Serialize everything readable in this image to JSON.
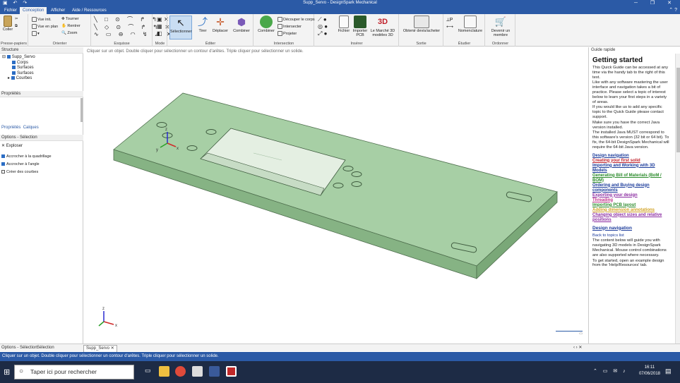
{
  "window": {
    "title": "Supp_Servo - DesignSpark Mechanical",
    "controls": "─  ❐  ✕"
  },
  "ribbon_tabs": [
    "Fichier",
    "Conception",
    "Afficher",
    "Aide / Ressources"
  ],
  "ribbon_active_tab": "Conception",
  "ribbon_groups": {
    "presse_papiers": {
      "label": "Presse-papiers",
      "coller": "Coller"
    },
    "orienter": {
      "label": "Orienter",
      "items": [
        "Vue init.",
        "Vue en plan",
        "Tourner",
        "Rentrer",
        "Zoom"
      ]
    },
    "esquisse": {
      "label": "Esquisse"
    },
    "mode": {
      "label": "Mode"
    },
    "editer": {
      "label": "Éditer",
      "buttons": [
        "Sélectionner",
        "Tirer",
        "Déplacer",
        "Combiner"
      ]
    },
    "intersection": {
      "label": "Intersection",
      "combine": "Combiner",
      "items": [
        "Découper le corps",
        "Intersecter",
        "Projeter"
      ]
    },
    "inserer": {
      "label": "Insérer",
      "items": [
        "Fichier",
        "Importer PCB",
        "Le Marché 3D modèles 3D"
      ]
    },
    "sortie": {
      "label": "Sortie",
      "items": [
        "Obtenir devis/acheter"
      ]
    },
    "etudier": {
      "label": "Étudier",
      "items": [
        "Nomenclature"
      ]
    },
    "ordonner": {
      "label": "Ordonner",
      "items": [
        "Devenir un membre"
      ]
    }
  },
  "structure_panel": {
    "title": "Structure",
    "root": "Supp_Servo",
    "children": [
      "Corps",
      "Surfaces",
      "Surfaces",
      "Courbes"
    ]
  },
  "properties_panel": {
    "title": "Propriétés",
    "tabs": [
      "Propriétés",
      "Calques"
    ]
  },
  "options_panel": {
    "title": "Options - Sélection",
    "mode": "Exploser",
    "options": [
      {
        "label": "Accrocher à la quadrillage",
        "checked": true
      },
      {
        "label": "Accrocher à l'angle",
        "checked": true
      },
      {
        "label": "Créer des courbes",
        "checked": false
      }
    ]
  },
  "viewport": {
    "hint": "Cliquer sur un objet. Double cliquer pour sélectionner un contour d'arêtes. Triple cliquer pour sélectionner un solide.",
    "axis_labels": [
      "x",
      "y",
      "z"
    ],
    "model_color": "#9cc79a"
  },
  "quick_guide": {
    "title": "Guide rapide",
    "heading": "Getting started",
    "paragraphs": [
      "This Quick Guide can be accessed at any time via the handy tab to the right of this text.",
      "Like with any software mastering the user interface and navigation takes a bit of practice. Please select a topic of interest below to learn your first steps in a variety of areas.",
      "If you would like us to add any specific topic to the Quick Guide please contact support.",
      "Make sure you have the correct Java version installed.",
      "The installed Java MUST correspond to this software's version (32 bit or 64 bit). To fix, the 64-bit DesignSpark Mechanical will require the 64-bit Java version."
    ],
    "links": [
      {
        "text": "Design navigation",
        "color": "#1a3a9a"
      },
      {
        "text": "Creating your first solid",
        "color": "#c0202a"
      },
      {
        "text": "Importing and Working with 3D Models",
        "color": "#1a3a9a"
      },
      {
        "text": "Generating Bill of Materials (BoM / BOM)",
        "color": "#2a8a2a"
      },
      {
        "text": "Ordering and Buying design components",
        "color": "#1a3a9a"
      },
      {
        "text": "Exporting your design",
        "color": "#8a2aa0"
      },
      {
        "text": "Threading",
        "color": "#c0308a"
      },
      {
        "text": "Importing PCB layout",
        "color": "#2a8a2a"
      },
      {
        "text": "Adding dimension annotations",
        "color": "#d0a020"
      },
      {
        "text": "Changing object sizes and relative positions",
        "color": "#8a2aa0"
      }
    ],
    "section2_title": "Design navigation",
    "back_link": "Back to topics list",
    "section2_paragraphs": [
      "The content below will guide you with navigating 3D models in DesignSpark Mechanical. Mouse control combinations are also supported where necessary.",
      "To get started, open an example design from the 'Help/Resources' tab."
    ]
  },
  "bottom_tabs": [
    "Options - Sélection",
    "Sélection"
  ],
  "document_tab": "Supp_Servo",
  "status_text": "Cliquer sur un objet. Double cliquer pour sélectionner un contour d'arêtes. Triple cliquer pour sélectionner un solide.",
  "taskbar": {
    "search_placeholder": "Taper ici pour rechercher",
    "time": "16:11",
    "date": "07/06/2018"
  }
}
